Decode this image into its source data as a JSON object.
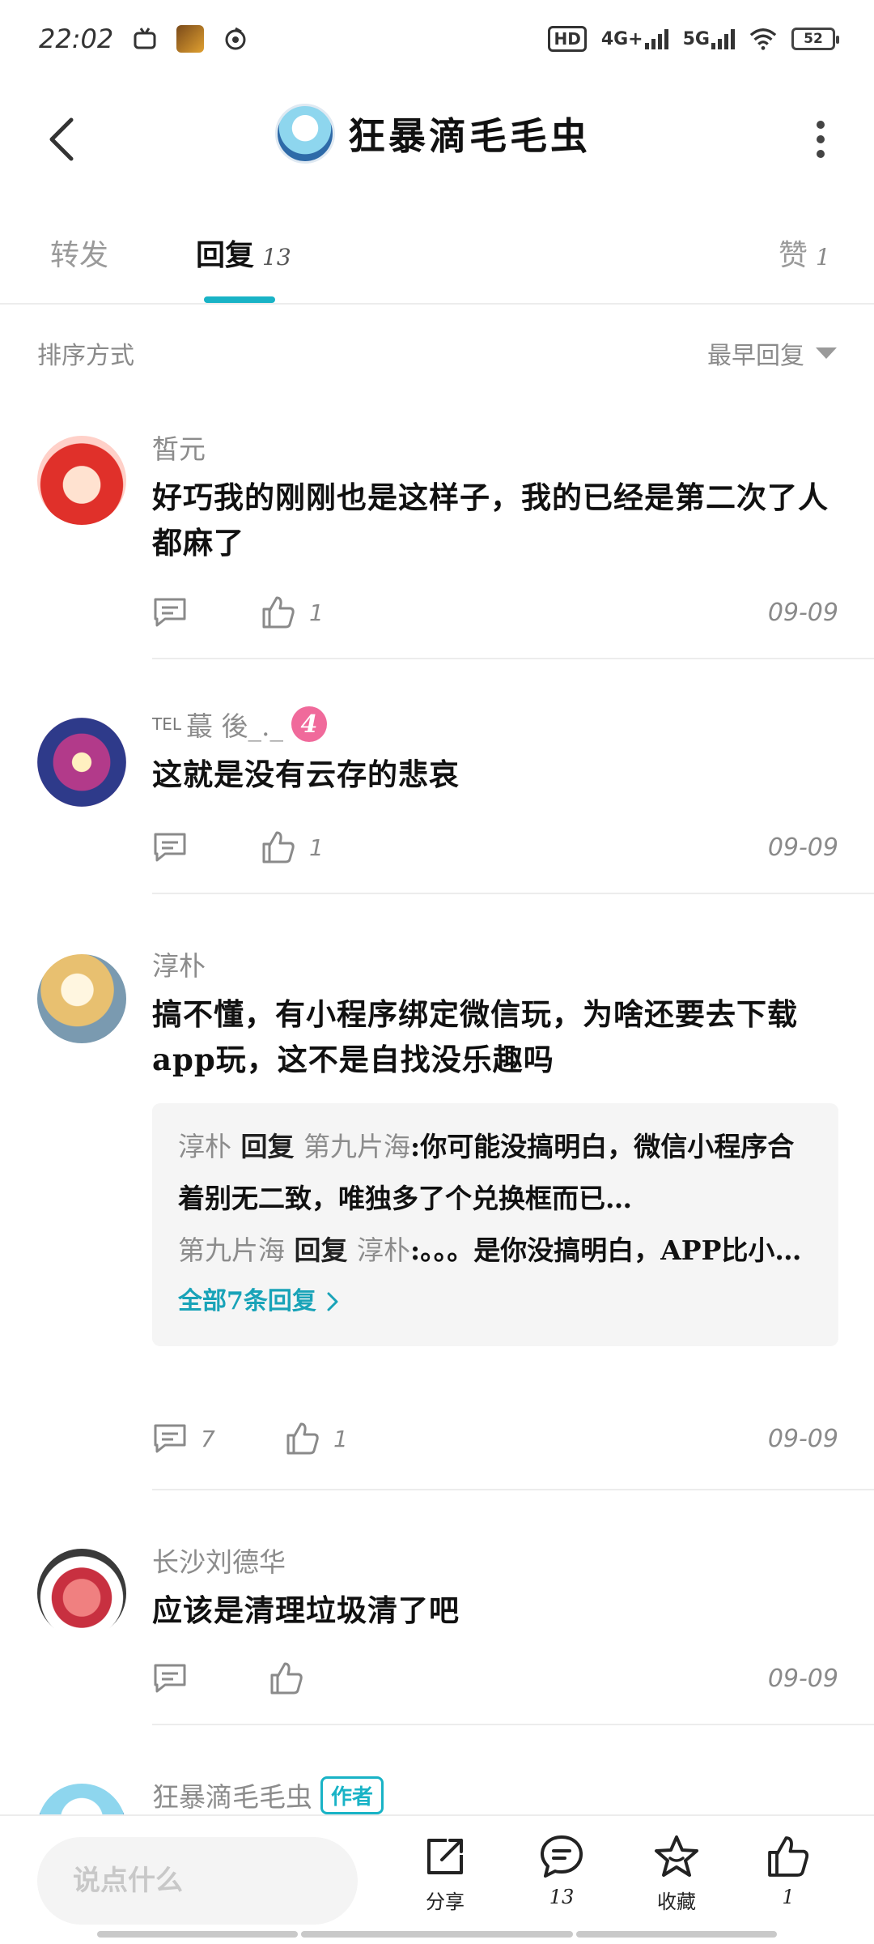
{
  "status_bar": {
    "time": "22:02",
    "hd": "HD",
    "net1": "4G+",
    "net2": "5G",
    "battery": "52"
  },
  "header": {
    "title": "狂暴滴毛毛虫"
  },
  "tabs": {
    "forward_label": "转发",
    "reply_label": "回复",
    "reply_count": "13",
    "like_label": "赞",
    "like_count": "1"
  },
  "sort": {
    "label": "排序方式",
    "value": "最早回复"
  },
  "comments": [
    {
      "name": "皙元",
      "text": "好巧我的刚刚也是这样子，我的已经是第二次了人都麻了",
      "likes": "1",
      "date": "09-09"
    },
    {
      "name_prefix": "TEL",
      "name": "蕞 後_._",
      "level": "4",
      "text": "这就是没有云存的悲哀",
      "likes": "1",
      "date": "09-09"
    },
    {
      "name": "淳朴",
      "text": "搞不懂，有小程序绑定微信玩，为啥还要去下载app玩，这不是自找没乐趣吗",
      "replies": [
        {
          "from": "淳朴",
          "kw": "回复",
          "to": "第九片海",
          "text": "你可能没搞明白，微信小程序合着别无二致，唯独多了个兑换框而已…"
        },
        {
          "from": "第九片海",
          "kw": "回复",
          "to": "淳朴",
          "text": "。。。是你没搞明白，APP比小程序的好很多，而且APP后面也会出…"
        }
      ],
      "all_replies": "全部7条回复",
      "reply_count": "7",
      "likes": "1",
      "date": "09-09"
    },
    {
      "name": "长沙刘德华",
      "text": "应该是清理垃圾清了吧",
      "date": "09-09"
    },
    {
      "name": "狂暴滴毛毛虫",
      "tag": "作者"
    }
  ],
  "bottom": {
    "input_placeholder": "说点什么",
    "share_label": "分享",
    "comment_count": "13",
    "fav_label": "收藏",
    "like_count": "1"
  },
  "colors": {
    "accent": "#19b3c6",
    "level_badge": "#f06a9b",
    "muted_text": "#8c8c8c"
  }
}
